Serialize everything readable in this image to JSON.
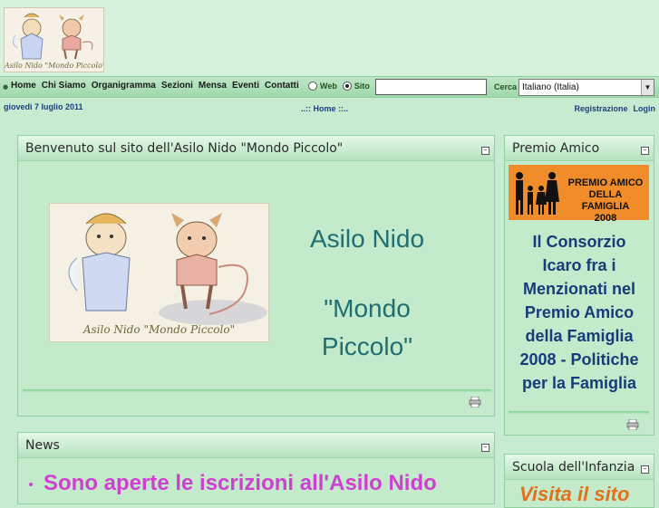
{
  "header": {
    "logo_caption": "Asilo Nido \"Mondo Piccolo\""
  },
  "nav": {
    "items": [
      "Home",
      "Chi Siamo",
      "Organigramma",
      "Sezioni",
      "Mensa",
      "Eventi",
      "Contatti"
    ],
    "radio_web": "Web",
    "radio_sito": "Sito",
    "radio_selected": "Sito",
    "search_value": "",
    "search_label": "Cerca",
    "language": "Italiano (Italia)"
  },
  "subbar": {
    "date": "giovedì 7 luglio 2011",
    "breadcrumb_prefix": "..:: ",
    "breadcrumb_home": "Home",
    "breadcrumb_suffix": " ::..",
    "register": "Registrazione",
    "login": "Login"
  },
  "welcome": {
    "title": "Benvenuto sul sito dell'Asilo Nido \"Mondo Piccolo\"",
    "image_caption": "Asilo Nido \"Mondo Piccolo\"",
    "line1": "Asilo Nido",
    "line2": "\"Mondo",
    "line3": "Piccolo\""
  },
  "premio": {
    "title": "Premio Amico",
    "banner_text": "PREMIO AMICO DELLA FAMIGLIA 2008",
    "banner_line1": "PREMIO AMICO",
    "banner_line2": "DELLA FAMIGLIA",
    "banner_line3": "2008",
    "body_lines": [
      "Il Consorzio",
      "Icaro fra i",
      "Menzionati nel",
      "Premio Amico",
      "della Famiglia",
      "2008 - Politiche",
      "per la Famiglia"
    ]
  },
  "news": {
    "title": "News",
    "headline": "Sono aperte le iscrizioni all'Asilo Nido"
  },
  "scuola": {
    "title": "Scuola dell'Infanzia",
    "teaser": "Visita il sito"
  },
  "colors": {
    "background": "#c7ebd0",
    "teal_heading": "#1f6e73",
    "side_text": "#163c7a",
    "news_headline": "#cf3fd0",
    "orange_link": "#e2701c"
  }
}
